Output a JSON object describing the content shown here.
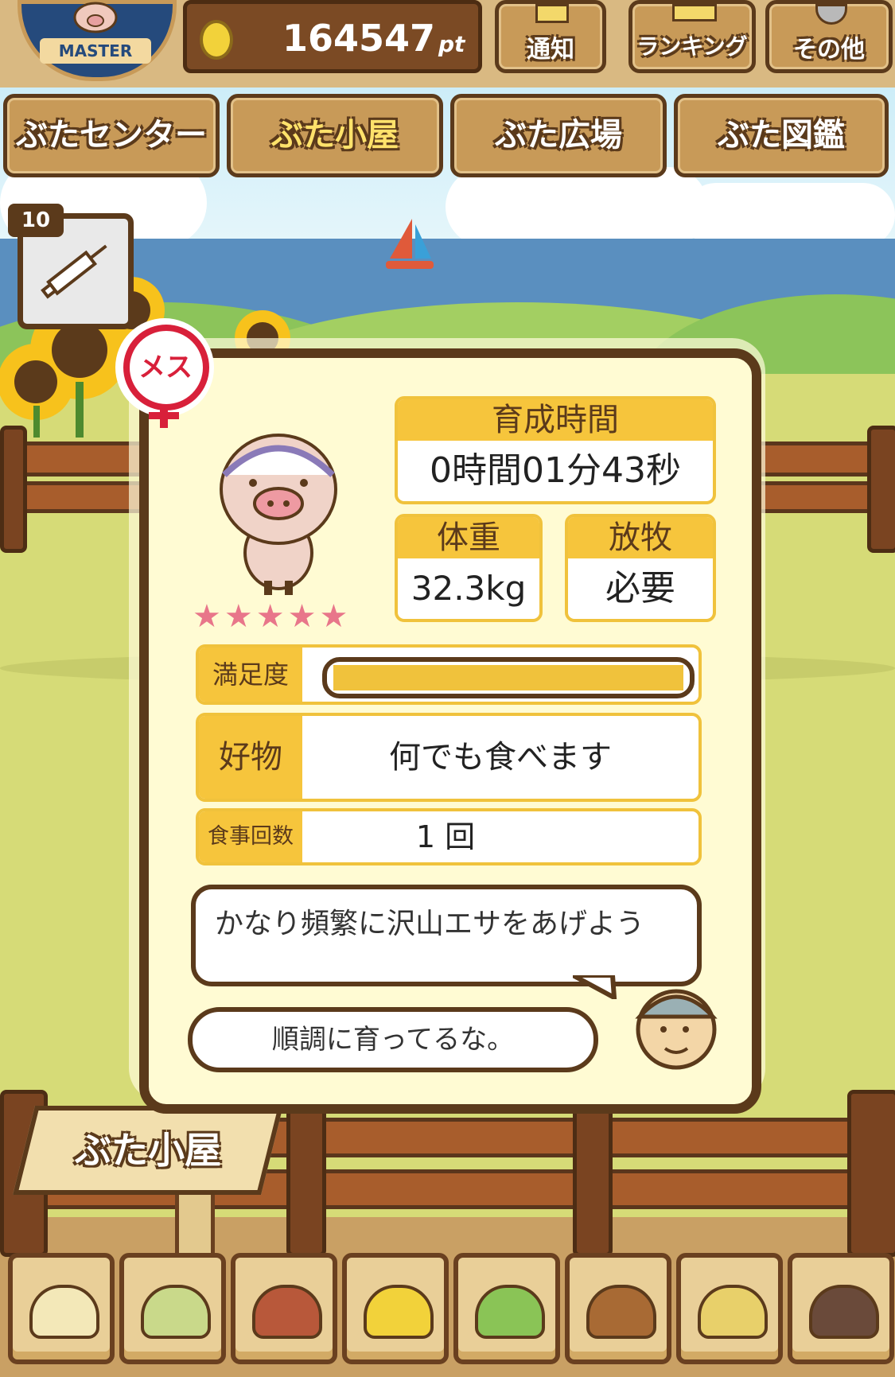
{
  "points": {
    "value": "164547",
    "unit": "pt"
  },
  "badge": {
    "label": "MASTER"
  },
  "top_buttons": [
    {
      "label": "通知",
      "icon": "notification-icon"
    },
    {
      "label": "ランキング",
      "icon": "ranking-icon"
    },
    {
      "label": "その他",
      "icon": "gear-icon"
    }
  ],
  "tabs": [
    {
      "label": "ぶたセンター",
      "active": false
    },
    {
      "label": "ぶた小屋",
      "active": true
    },
    {
      "label": "ぶた広場",
      "active": false
    },
    {
      "label": "ぶた図鑑",
      "active": false
    }
  ],
  "syringe": {
    "count": "10",
    "icon": "syringe-icon"
  },
  "pig": {
    "gender_label": "メス",
    "stars": 5,
    "growth_time_label": "育成時間",
    "growth_time_value": "0時間01分43秒",
    "weight_label": "体重",
    "weight_value": "32.3kg",
    "grazing_label": "放牧",
    "grazing_value": "必要",
    "satisfaction_label": "満足度",
    "satisfaction_level": 1.0,
    "favorite_label": "好物",
    "favorite_value": "何でも食べます",
    "meals_label": "食事回数",
    "meals_value": "1 回",
    "advice": "かなり頻繁に沢山エサをあげよう",
    "comment": "順調に育ってるな。"
  },
  "signboard": {
    "label": "ぶた小屋"
  },
  "feed_tray": [
    "small-grain-feed-icon",
    "mixed-grain-feed-icon",
    "sweet-potato-icon",
    "corn-icon",
    "greens-feed-icon",
    "acorn-icon",
    "soybean-plate-icon",
    "truffle-plate-icon"
  ],
  "colors": {
    "accent": "#f6c53c",
    "wood_dark": "#5b3a1b",
    "panel": "#fffbd3",
    "star": "#e8768a",
    "female": "#d8203a"
  }
}
